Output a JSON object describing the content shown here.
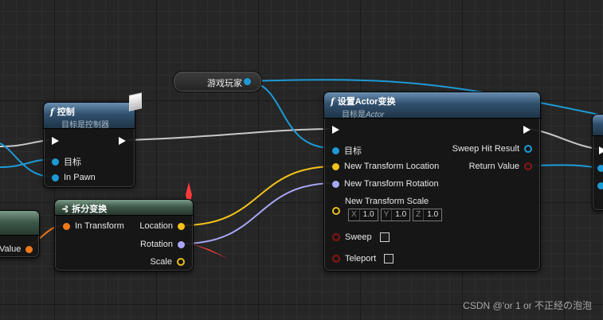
{
  "variable_node": {
    "label": "游戏玩家"
  },
  "control_node": {
    "title": "控制",
    "subtitle": "目标是控制器",
    "pins": {
      "target": "目标",
      "in_pawn": "In Pawn"
    }
  },
  "break_transform_node": {
    "title": "拆分变换",
    "pins": {
      "in_transform": "In Transform",
      "location": "Location",
      "rotation": "Rotation",
      "scale": "Scale"
    }
  },
  "left_cut_node": {
    "pin_label": "Value"
  },
  "set_actor_transform_node": {
    "title": "设置Actor变换",
    "subtitle_prefix": "目标是",
    "subtitle_target": "Actor",
    "pins": {
      "target": "目标",
      "new_location": "New Transform Location",
      "new_rotation": "New Transform Rotation",
      "new_scale": "New Transform Scale",
      "sweep": "Sweep",
      "teleport": "Teleport",
      "sweep_hit_result": "Sweep Hit Result",
      "return_value": "Return Value"
    },
    "scale_fields": [
      {
        "axis": "X",
        "value": "1.0"
      },
      {
        "axis": "Y",
        "value": "1.0"
      },
      {
        "axis": "Z",
        "value": "1.0"
      }
    ]
  },
  "watermark": "CSDN @'or 1 or 不正经の泡泡",
  "colors": {
    "object_wire": "#1d9ad6",
    "exec_wire": "#c8c8c8",
    "vector_wire": "#f4c21a",
    "rotator_wire": "#a9a6f5",
    "transform_wire": "#f1781a",
    "annotation_arrow": "#ff3b3b"
  },
  "icons": [
    "function-icon",
    "break-struct-icon",
    "pawn-icon",
    "exec-pin-icon"
  ]
}
